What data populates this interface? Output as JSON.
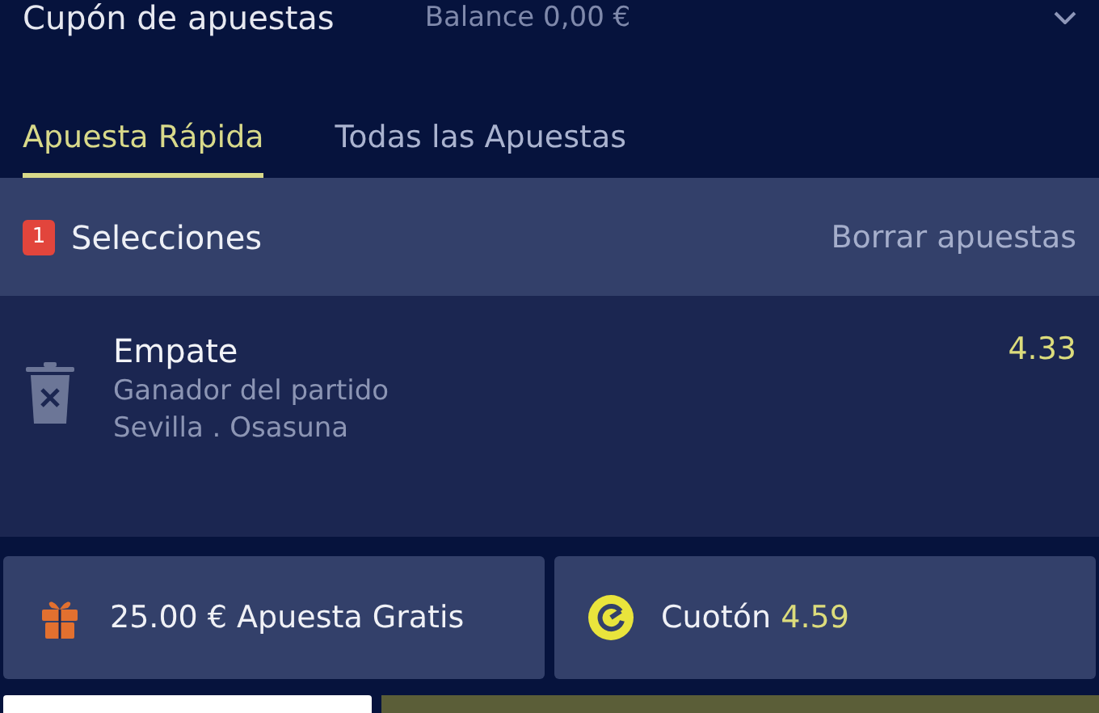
{
  "header": {
    "title": "Cupón de apuestas",
    "balance": "Balance 0,00 €"
  },
  "tabs": [
    {
      "label": "Apuesta Rápida",
      "selected": true
    },
    {
      "label": "Todas las Apuestas",
      "selected": false
    }
  ],
  "selections": {
    "count": "1",
    "label": "Selecciones",
    "clear": "Borrar apuestas"
  },
  "bets": [
    {
      "pick": "Empate",
      "market": "Ganador del partido",
      "event": "Sevilla . Osasuna",
      "odds": "4.33"
    }
  ],
  "options": [
    {
      "kind": "free_bet",
      "text": "25.00 € Apuesta Gratis"
    },
    {
      "kind": "boost",
      "text": "Cuotón",
      "value": "4.59"
    }
  ]
}
